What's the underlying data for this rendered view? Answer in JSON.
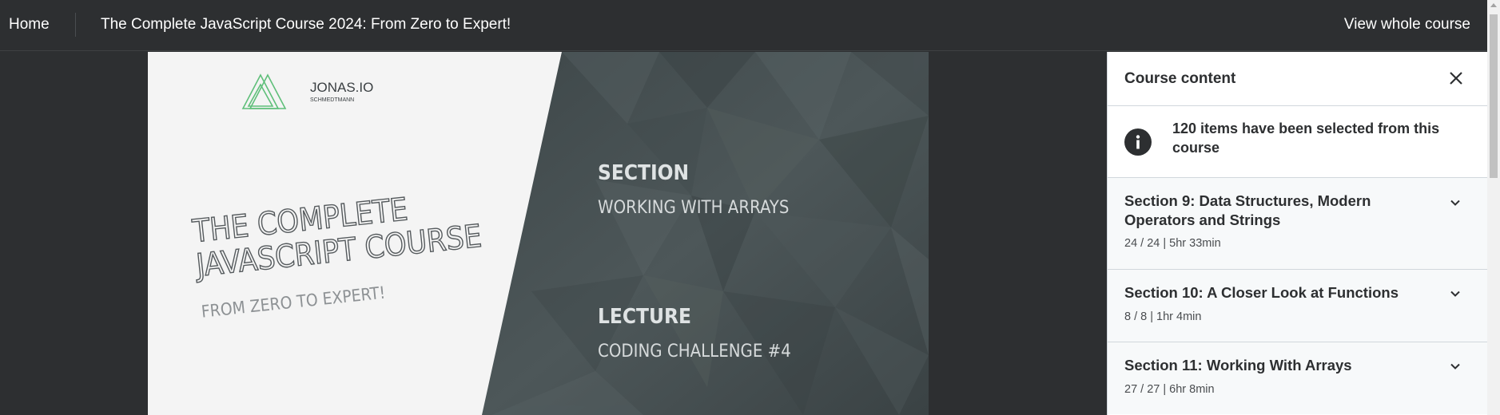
{
  "topbar": {
    "home_label": "Home",
    "course_title": "The Complete JavaScript Course 2024: From Zero to Expert!",
    "view_whole_label": "View whole course"
  },
  "slide": {
    "logo_name": "JONAS.IO",
    "logo_sub": "SCHMEDTMANN",
    "course_line1": "THE COMPLETE",
    "course_line2": "JAVASCRIPT COURSE",
    "course_tagline": "FROM ZERO TO EXPERT!",
    "section_heading": "SECTION",
    "section_name": "WORKING WITH ARRAYS",
    "lecture_heading": "LECTURE",
    "lecture_name": "CODING CHALLENGE #4"
  },
  "panel": {
    "title": "Course content",
    "info_message": "120 items have been selected from this course",
    "sections": [
      {
        "title_line1": "Section 9: Data Structures, Modern",
        "title_line2": "Operators and Strings",
        "meta": "24 / 24 | 5hr 33min"
      },
      {
        "title_line1": "Section 10: A Closer Look at Functions",
        "meta": "8 / 8 | 1hr 4min"
      },
      {
        "title_line1": "Section 11: Working With Arrays",
        "meta": "27 / 27 | 6hr 8min"
      }
    ]
  },
  "colors": {
    "topbar_bg": "#2d2f31",
    "panel_bg": "#ffffff",
    "section_bg": "#f7f9fa",
    "slide_light": "#f4f4f4",
    "slide_dark": "#4a5456",
    "logo_green": "#5fbf7a"
  },
  "icons": {
    "close": "close-icon",
    "info": "info-icon",
    "chevron": "chevron-down-icon"
  }
}
